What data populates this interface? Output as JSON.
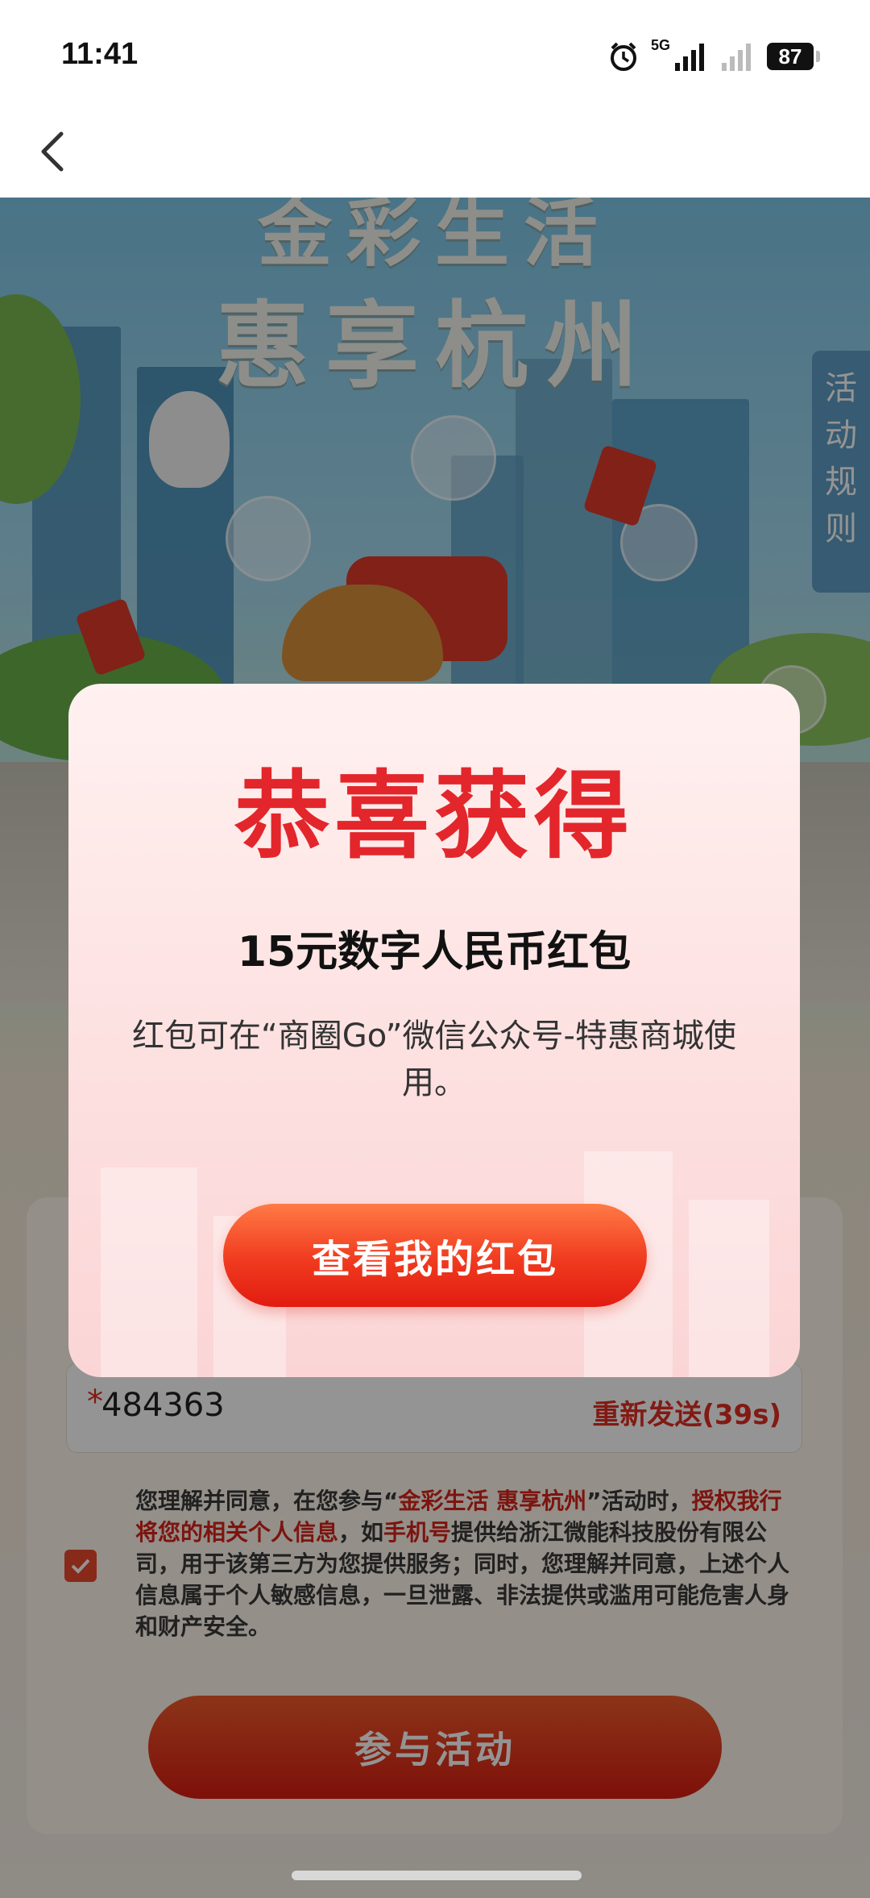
{
  "status_bar": {
    "time": "11:41",
    "network": "5G",
    "battery": "87"
  },
  "hero": {
    "title_line1": "金彩生活",
    "title_line2": "惠享杭州",
    "rules_tab": "活动规则"
  },
  "form": {
    "code_value": "484363",
    "code_required_mark": "*",
    "resend_label": "重新发送(39s)",
    "checkbox_checked": true,
    "agreement_parts": {
      "p1": "您理解并同意，在您参与“",
      "h1": "金彩生活 惠享杭州",
      "p2": "”活动时，",
      "h2": "授权我行将您的相关个人信息",
      "p3": "，如",
      "h3": "手机号",
      "p4": "提供给浙江微能科技股份有限公司，用于该第三方为您提供服务；同时，您理解并同意，上述个人信息属于个人敏感信息，一旦泄露、非法提供或滥用可能危害人身和财产安全。"
    },
    "join_button": "参与活动"
  },
  "modal": {
    "title": "恭喜获得",
    "amount": "15元数字人民币红包",
    "description": "红包可在“商圈Go”微信公众号-特惠商城使用。",
    "button": "查看我的红包"
  },
  "colors": {
    "accent_red": "#e3262b",
    "button_orange": "#f03a1f"
  }
}
